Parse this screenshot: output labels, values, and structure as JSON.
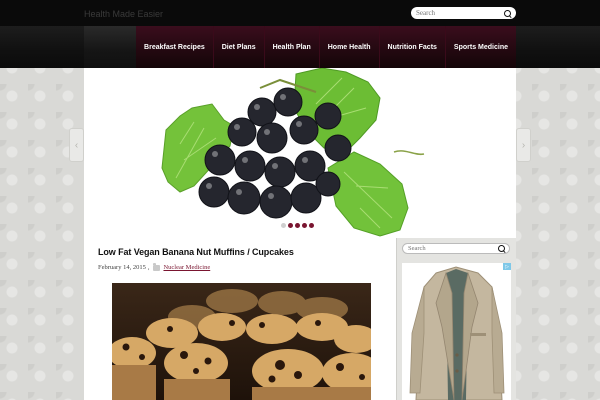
{
  "top_search": {
    "placeholder": "Search"
  },
  "site_title": "Health Made Easier",
  "nav": [
    {
      "label": "Breakfast Recipes"
    },
    {
      "label": "Diet Plans"
    },
    {
      "label": "Health Plan"
    },
    {
      "label": "Home Health"
    },
    {
      "label": "Nutrition Facts"
    },
    {
      "label": "Sports Medicine"
    }
  ],
  "slider": {
    "arrow_prev": "‹",
    "arrow_next": "›",
    "slide_count": 5,
    "active_slide": 1
  },
  "post": {
    "title": "Low Fat Vegan Banana Nut Muffins / Cupcakes",
    "date": "February 14, 2015",
    "category": "Nuclear Medicine"
  },
  "sidebar": {
    "search_placeholder": "Search",
    "ad_badge": "▷"
  },
  "colors": {
    "accent": "#7a1530",
    "nav_bg": "#2a0a14",
    "topbar": "#0a0a0a"
  },
  "icons": [
    "search-icon",
    "folder-icon",
    "chevron-left-icon",
    "chevron-right-icon",
    "adchoices-icon"
  ]
}
